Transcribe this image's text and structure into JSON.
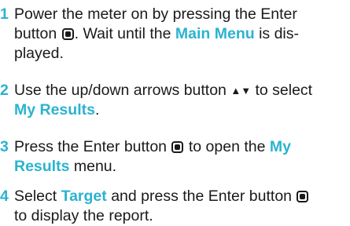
{
  "steps": [
    {
      "number": "1",
      "l1": "Power the meter on by pressing the Enter",
      "l2a": "button",
      "l2b": ". Wait until the",
      "l2c": "Main Menu",
      "l2d": "is dis-",
      "l3": "played."
    },
    {
      "number": "2",
      "l1a": "Use the up/down arrows button",
      "arrows": "▲▼",
      "l1b": "to select",
      "l2": "My Results",
      "l2end": "."
    },
    {
      "number": "3",
      "l1a": "Press the Enter button",
      "l1b": "to open the",
      "l1c": "My",
      "l2a": "Results",
      "l2b": "menu."
    },
    {
      "number": "4",
      "l1a": "Select",
      "l1b": "Target",
      "l1c": "and press the Enter button",
      "l2": "to display the report."
    }
  ],
  "icons": {
    "enter": "enter-button-icon",
    "arrows": "up-down-arrows-icon"
  },
  "colors": {
    "accent": "#2bb3d0",
    "text": "#1a1a1a"
  }
}
